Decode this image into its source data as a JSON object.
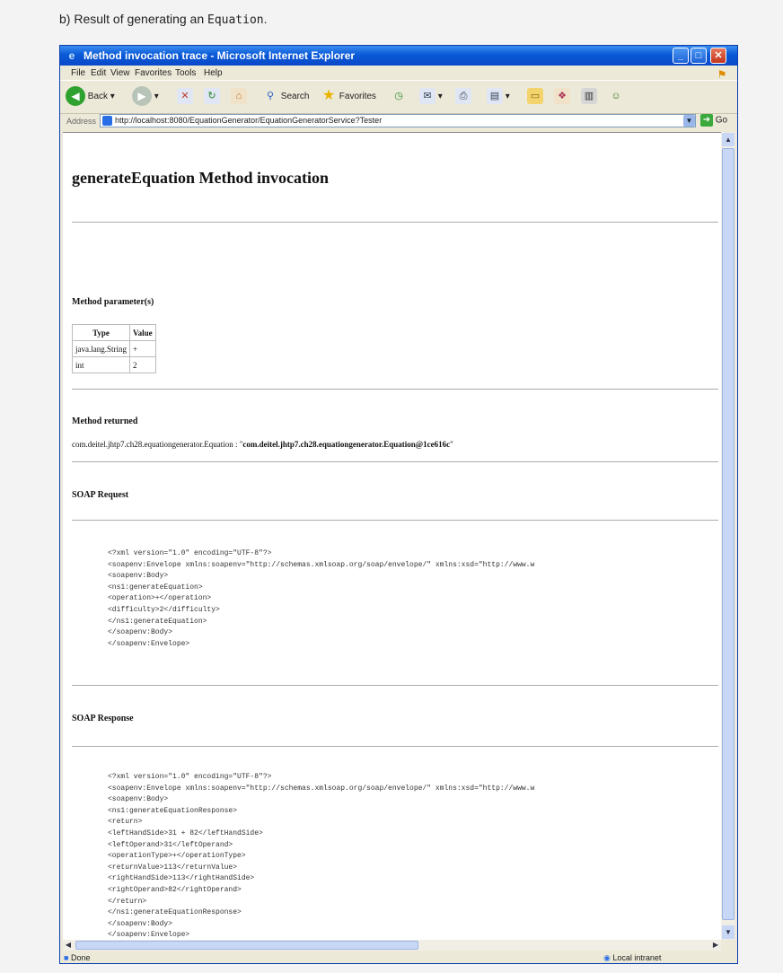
{
  "caption": {
    "prefix": "b) Result of generating an ",
    "code": "Equation",
    "suffix": "."
  },
  "window": {
    "title": "Method invocation trace - Microsoft Internet Explorer",
    "menu": [
      "File",
      "Edit",
      "View",
      "Favorites",
      "Tools",
      "Help"
    ],
    "toolbar": {
      "back": "Back",
      "search": "Search",
      "favorites": "Favorites"
    },
    "address": {
      "label": "Address",
      "url": "http://localhost:8080/EquationGenerator/EquationGeneratorService?Tester",
      "go": "Go"
    },
    "status": {
      "left": "Done",
      "right": "Local intranet"
    }
  },
  "page": {
    "heading": "generateEquation Method invocation",
    "params_heading": "Method parameter(s)",
    "params_table": {
      "headers": [
        "Type",
        "Value"
      ],
      "rows": [
        [
          "java.lang.String",
          "+"
        ],
        [
          "int",
          "2"
        ]
      ]
    },
    "returned_heading": "Method returned",
    "returned_type": "com.deitel.jhtp7.ch28.equationgenerator.Equation : \"",
    "returned_value": "com.deitel.jhtp7.ch28.equationgenerator.Equation@1ce616c",
    "returned_close": "\"",
    "soap_request_heading": "SOAP Request",
    "soap_request": "<?xml version=\"1.0\" encoding=\"UTF-8\"?>\n<soapenv:Envelope xmlns:soapenv=\"http://schemas.xmlsoap.org/soap/envelope/\" xmlns:xsd=\"http://www.w\n<soapenv:Body>\n<ns1:generateEquation>\n<operation>+</operation>\n<difficulty>2</difficulty>\n</ns1:generateEquation>\n</soapenv:Body>\n</soapenv:Envelope>",
    "soap_response_heading": "SOAP Response",
    "soap_response": "<?xml version=\"1.0\" encoding=\"UTF-8\"?>\n<soapenv:Envelope xmlns:soapenv=\"http://schemas.xmlsoap.org/soap/envelope/\" xmlns:xsd=\"http://www.w\n<soapenv:Body>\n<ns1:generateEquationResponse>\n<return>\n<leftHandSide>31 + 82</leftHandSide>\n<leftOperand>31</leftOperand>\n<operationType>+</operationType>\n<returnValue>113</returnValue>\n<rightHandSide>113</rightHandSide>\n<rightOperand>82</rightOperand>\n</return>\n</ns1:generateEquationResponse>\n</soapenv:Body>\n</soapenv:Envelope>"
  },
  "colors": {
    "titlebar": "#0a5ad8",
    "chrome": "#ece9d8",
    "scroll": "#c7d7f5"
  }
}
